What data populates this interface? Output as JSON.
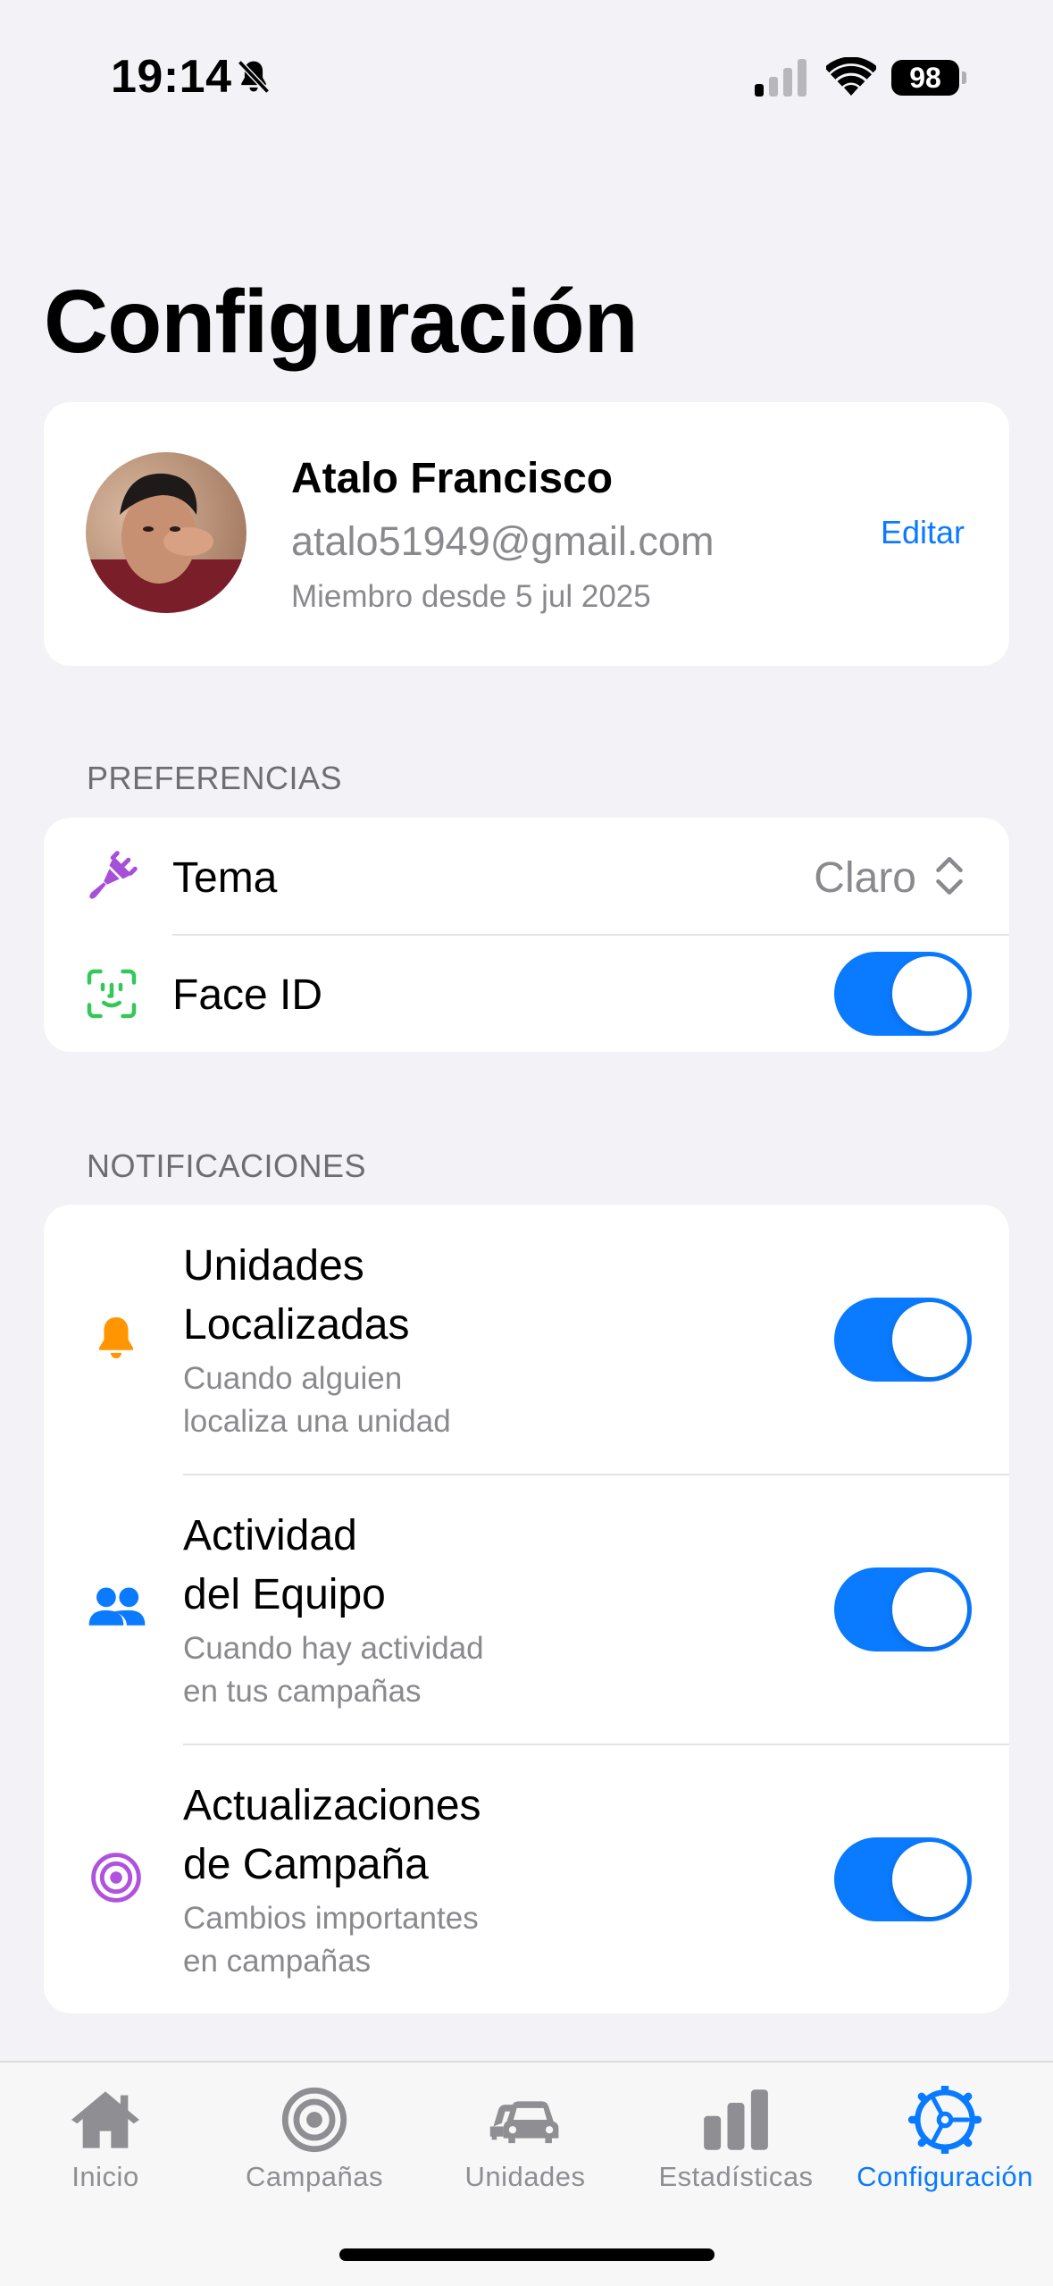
{
  "status_bar": {
    "time": "19:14",
    "battery": "98",
    "icons": [
      "bell-slash-icon",
      "cellular-signal-icon",
      "wifi-icon",
      "battery-icon"
    ]
  },
  "page": {
    "title": "Configuración"
  },
  "profile": {
    "name": "Atalo Francisco",
    "email": "atalo51949@gmail.com",
    "member_since": "Miembro desde 5 jul 2025",
    "edit_label": "Editar"
  },
  "preferences": {
    "header": "PREFERENCIAS",
    "theme": {
      "label": "Tema",
      "value": "Claro",
      "icon": "paintbrush-icon"
    },
    "face_id": {
      "label": "Face ID",
      "enabled": true,
      "icon": "faceid-icon"
    }
  },
  "notifications": {
    "header": "NOTIFICACIONES",
    "items": [
      {
        "title_line1": "Unidades",
        "title_line2": "Localizadas",
        "sub_line1": "Cuando alguien",
        "sub_line2": "localiza una unidad",
        "enabled": true,
        "icon": "bell-icon"
      },
      {
        "title_line1": "Actividad",
        "title_line2": "del Equipo",
        "sub_line1": "Cuando hay actividad",
        "sub_line2": "en tus campañas",
        "enabled": true,
        "icon": "people-icon"
      },
      {
        "title_line1": "Actualizaciones",
        "title_line2": "de Campaña",
        "sub_line1": "Cambios importantes",
        "sub_line2": "en campañas",
        "enabled": true,
        "icon": "target-icon"
      }
    ]
  },
  "tab_bar": {
    "active": "Configuración",
    "tabs": [
      {
        "label": "Inicio",
        "icon": "house-icon"
      },
      {
        "label": "Campañas",
        "icon": "target-icon"
      },
      {
        "label": "Unidades",
        "icon": "cars-icon"
      },
      {
        "label": "Estadísticas",
        "icon": "bar-chart-icon"
      },
      {
        "label": "Configuración",
        "icon": "gear-icon"
      }
    ]
  },
  "colors": {
    "accent": "#0a7aff",
    "background": "#f2f2f7",
    "secondary_text": "#8a8a8e",
    "theme_icon": "#a64fd8",
    "faceid_icon": "#34c759",
    "bell_icon": "#ff9500",
    "people_icon": "#0a7aff",
    "target_icon": "#af52de"
  }
}
